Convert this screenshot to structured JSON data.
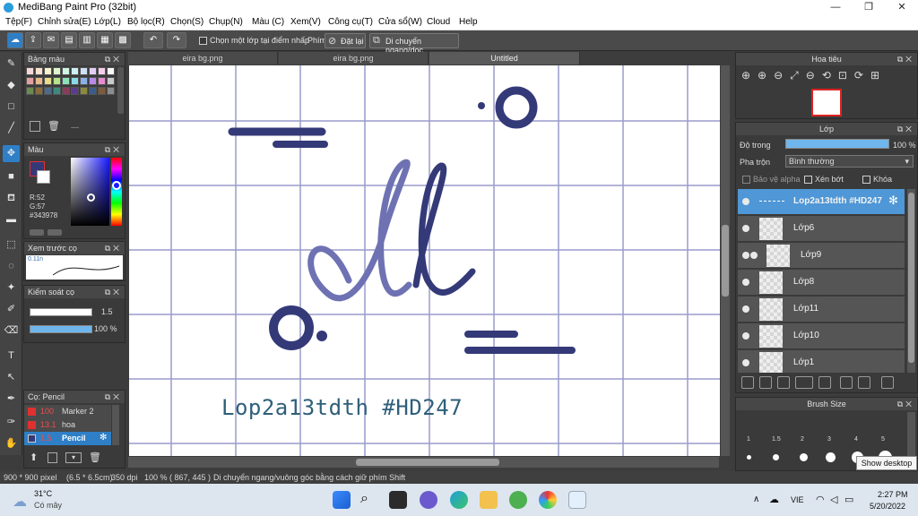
{
  "window": {
    "title": "MediBang Paint Pro (32bit)",
    "controls": [
      "—",
      "❐",
      "✕"
    ]
  },
  "menu": [
    "Tệp(F)",
    "Chỉnh sửa(E)",
    "Lớp(L)",
    "Bộ lọc(R)",
    "Chọn(S)",
    "Chụp(N)",
    "Màu (C)",
    "Xem(V)",
    "Công cụ(T)",
    "Cửa sổ(W)",
    "Cloud",
    "Help"
  ],
  "toolbar": {
    "select_layer_label": "Chọn một lớp tại điểm nhấp",
    "key_label": "Phím",
    "reset_label": "Đặt lại",
    "move_label": "Di chuyển ngang/dọc"
  },
  "palette": {
    "title": "Bảng màu",
    "more": "---",
    "colors": [
      "#f6d7d7",
      "#f7e3cf",
      "#f7f2cf",
      "#dff5cf",
      "#cff5e3",
      "#cfeff5",
      "#cfdff5",
      "#e3cff5",
      "#f5cfe9",
      "#f9f9f9",
      "#e3a0a0",
      "#e8b98a",
      "#e8dc8a",
      "#b4e38a",
      "#8ae3b8",
      "#8ad9e8",
      "#8ab0e8",
      "#b78ae8",
      "#e88acd",
      "#c9c9c9",
      "#6b8a4f",
      "#8a6b3c",
      "#4f6b8a",
      "#3c8a7d",
      "#8a3c5c",
      "#5c3c8a",
      "#8a8a3c",
      "#3c5c8a",
      "#7d5c3c",
      "#8c8c8c"
    ]
  },
  "color": {
    "title": "Màu",
    "r": "R:52",
    "g": "G:57",
    "b": "B:120",
    "hex": "#343978",
    "fg": "#343978"
  },
  "brush_preview": {
    "title": "Xem trước cọ",
    "size": "0.11n"
  },
  "brush_control": {
    "title": "Kiểm soát cọ",
    "size_value": "1.5",
    "opacity_value": "100 %"
  },
  "brush_list": {
    "title": "Cọ: Pencil",
    "items": [
      {
        "size": "100",
        "name": "Marker 2",
        "color": "#e03030"
      },
      {
        "size": "13.1",
        "name": "hoa",
        "color": "#e03030"
      },
      {
        "size": "1.5",
        "name": "Pencil",
        "color": "#343978"
      }
    ]
  },
  "document_tabs": [
    "eira bg.png",
    "eira bg.png",
    "Untitled"
  ],
  "canvas": {
    "text": "Lop2a13tdth #HD247",
    "ink": "#343978",
    "grid": "#9a9ccc"
  },
  "navigator": {
    "title": "Hoa tiêu"
  },
  "layers": {
    "title": "Lớp",
    "opacity_label": "Độ trong",
    "opacity_value": "100 %",
    "opacity_fraction": 1.0,
    "blend_label": "Pha trộn",
    "blend_value": "Bình thường",
    "protect_alpha": "Bảo vệ alpha",
    "clipping": "Xén bớt",
    "lock": "Khóa",
    "items": [
      {
        "name": "Lop2a13tdth #HD247",
        "selected": true
      },
      {
        "name": "Lớp6",
        "selected": false
      },
      {
        "name": "Lớp9",
        "selected": false
      },
      {
        "name": "Lớp8",
        "selected": false
      },
      {
        "name": "Lớp11",
        "selected": false
      },
      {
        "name": "Lớp10",
        "selected": false
      },
      {
        "name": "Lớp1",
        "selected": false
      }
    ]
  },
  "brush_size": {
    "title": "Brush Size",
    "labels": [
      "1",
      "1.5",
      "2",
      "3",
      "4",
      "5"
    ],
    "tooltip": "Show desktop"
  },
  "status": {
    "size": "900 * 900 pixel",
    "cm": "(6.5 * 6.5cm)",
    "dpi": "350 dpi",
    "zoom": "100 %",
    "coords": "( 867, 445 )",
    "hint": "Di chuyển ngang/vuông góc bằng cách giữ phím Shift"
  },
  "taskbar": {
    "temp": "31°C",
    "weather": "Có mây",
    "lang": "VIE",
    "time": "2:27 PM",
    "date": "5/20/2022"
  }
}
